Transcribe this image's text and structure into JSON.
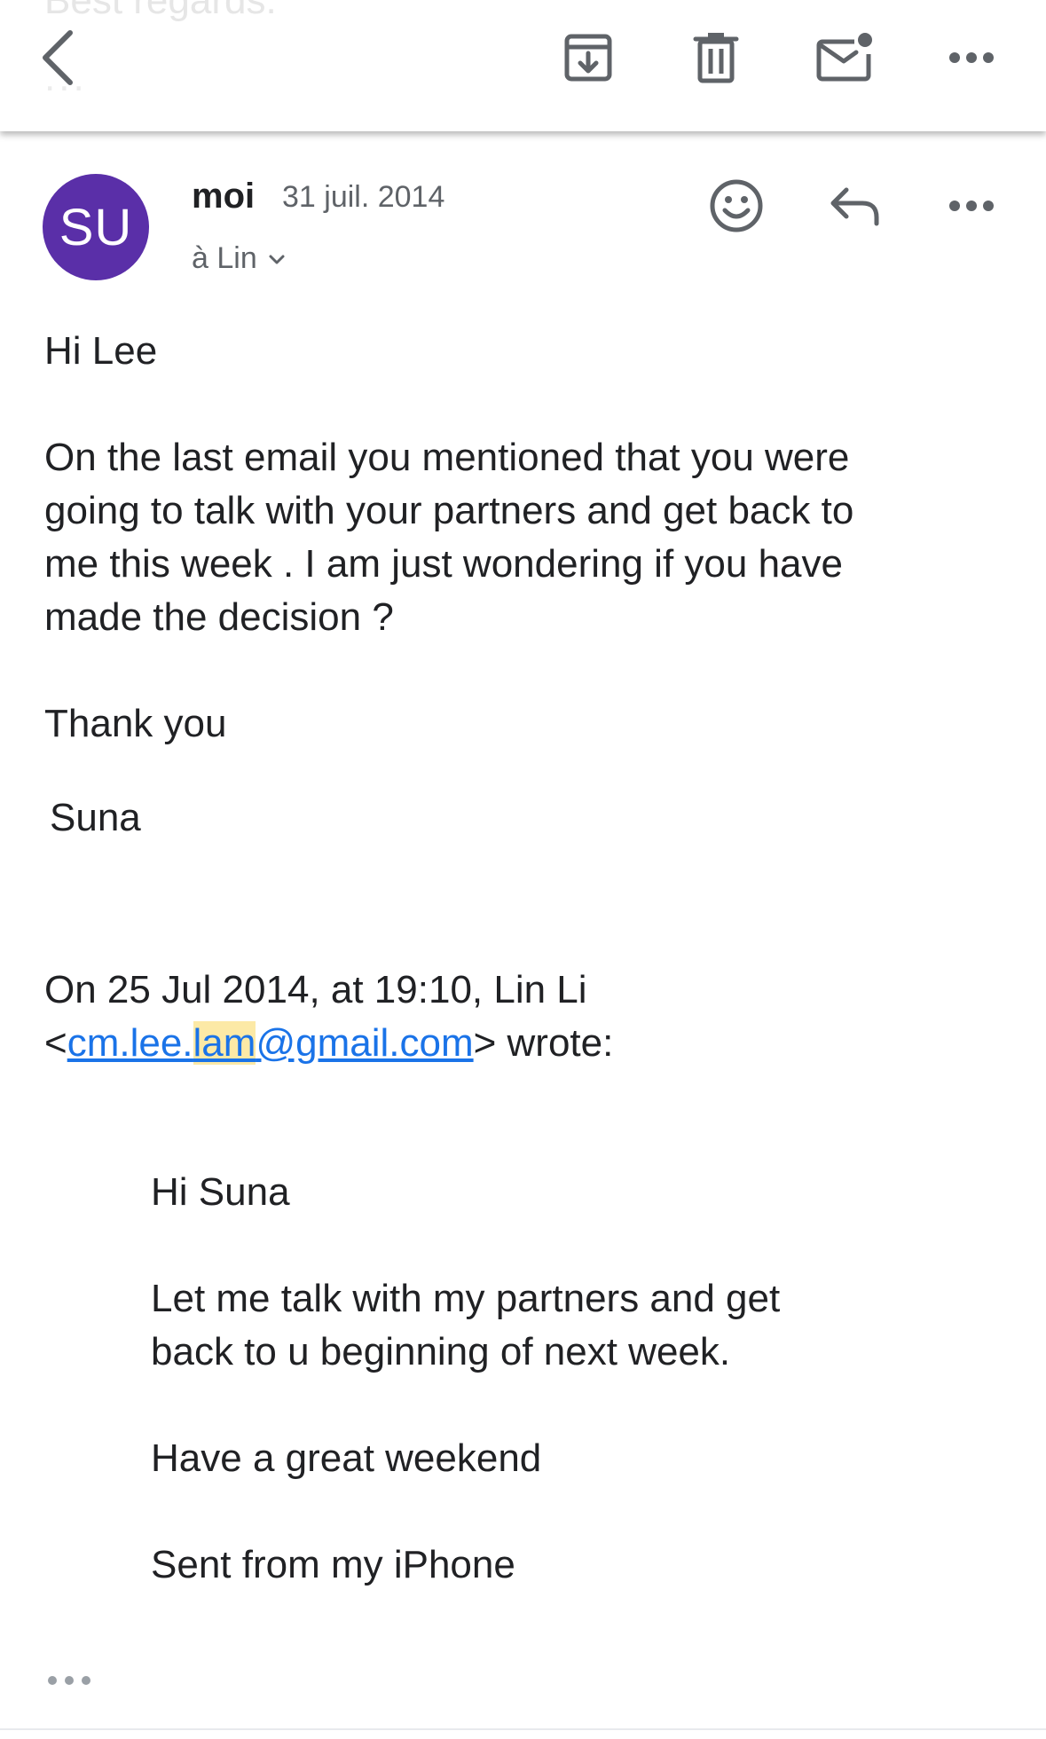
{
  "previous_message": {
    "preview_text": "Best regards.",
    "dots": "..."
  },
  "toolbar": {
    "back_icon": "chevron-left-icon",
    "archive_icon": "archive-icon",
    "delete_icon": "trash-icon",
    "unread_icon": "mark-unread-icon",
    "more_icon": "more-horizontal-icon"
  },
  "message": {
    "avatar_initials": "SU",
    "avatar_color": "#5a2fa8",
    "sender": "moi",
    "date": "31 juil. 2014",
    "recipients_label": "à Lin",
    "body": {
      "greeting": "Hi Lee",
      "paragraph_lines": [
        "On the last email you mentioned that you were",
        "going to talk with your partners and get back to",
        "me this week . I am just wondering if you have",
        "made the decision ?"
      ],
      "thanks": "Thank you",
      "signature": "Suna"
    },
    "quote_header": {
      "line1": "On 25 Jul 2014, at 19:10, Lin Li",
      "open_bracket": "<",
      "email_part1": "cm.lee.",
      "email_highlight": "lam",
      "email_part2": "@gmail.com",
      "close_wrote": "> wrote:"
    },
    "quoted": {
      "greeting": "Hi Suna",
      "paragraph_lines": [
        "Let me talk with my partners and get",
        "back to u beginning of next week."
      ],
      "weekend": "Have a great weekend",
      "sent_from": "Sent from my iPhone"
    }
  },
  "colors": {
    "link": "#1a73e8",
    "highlight": "#fce9a6",
    "icon": "#5f6368"
  }
}
